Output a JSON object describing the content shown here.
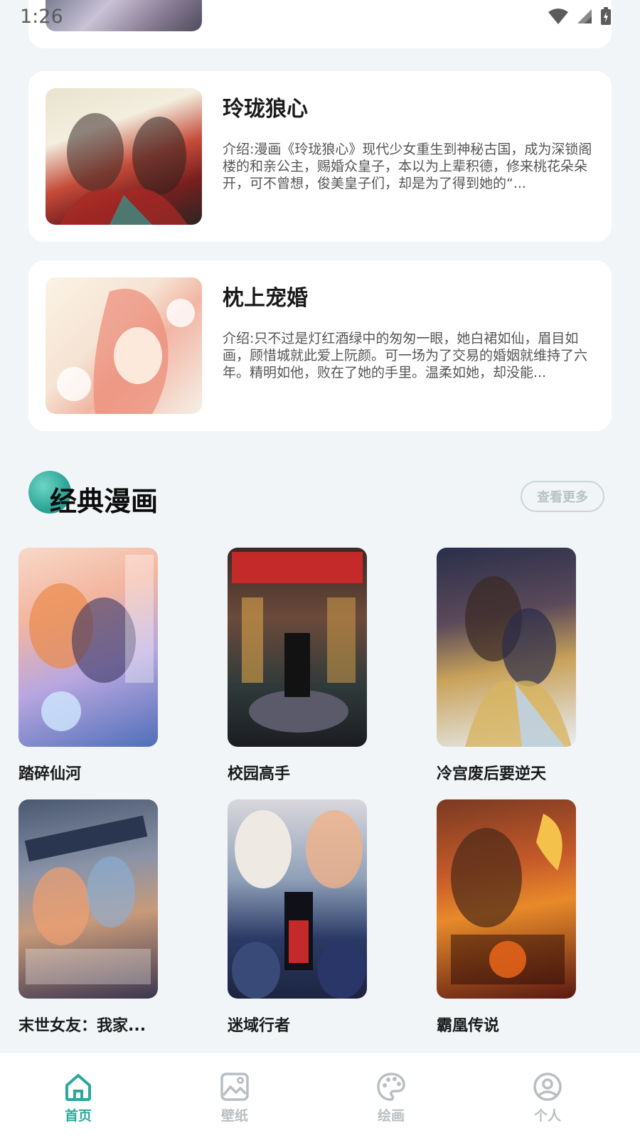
{
  "status_bar": {
    "time": "1:26"
  },
  "book_list": [
    {
      "title": "玲珑狼心",
      "description": "介绍:漫画《玲珑狼心》现代少女重生到神秘古国，成为深锁阁楼的和亲公主，赐婚众皇子，本以为上辈积德，修来桃花朵朵开，可不曾想，俊美皇子们，却是为了得到她的“..."
    },
    {
      "title": "枕上宠婚",
      "description": "介绍:只不过是灯红酒绿中的匆匆一眼，她白裙如仙，眉目如画，顾惜城就此爱上阮颜。可一场为了交易的婚姻就维持了六年。精明如他，败在了她的手里。温柔如她，却没能..."
    }
  ],
  "classic_section": {
    "title": "经典漫画",
    "more_label": "查看更多",
    "items": [
      {
        "name": "踏碎仙河"
      },
      {
        "name": "校园高手"
      },
      {
        "name": "冷宫废后要逆天"
      },
      {
        "name": "末世女友：我家..."
      },
      {
        "name": "迷域行者"
      },
      {
        "name": "霸凰传说"
      }
    ]
  },
  "bottom_nav": {
    "items": [
      {
        "label": "首页",
        "icon": "home-icon",
        "active": true
      },
      {
        "label": "壁纸",
        "icon": "image-icon",
        "active": false
      },
      {
        "label": "绘画",
        "icon": "palette-icon",
        "active": false
      },
      {
        "label": "个人",
        "icon": "user-icon",
        "active": false
      }
    ]
  },
  "colors": {
    "accent": "#2aa89b",
    "background": "#f1f5f7",
    "card": "#ffffff",
    "inactive_nav": "#b9bec2"
  }
}
